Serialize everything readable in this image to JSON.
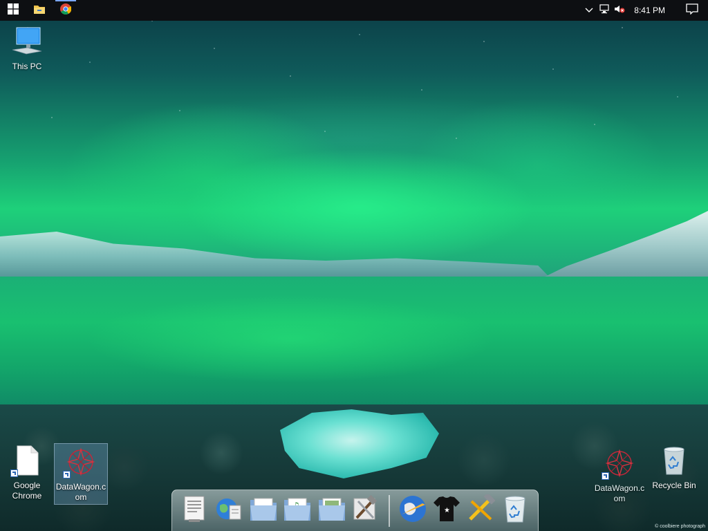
{
  "taskbar": {
    "start_icon": "windows-logo-icon",
    "pinned": [
      {
        "icon": "file-explorer-icon"
      },
      {
        "icon": "chrome-icon"
      }
    ],
    "tray": {
      "icons": [
        "chevron-up-icon",
        "network-icon",
        "volume-muted-icon"
      ],
      "clock": "8:41 PM",
      "notification_icon": "action-center-icon"
    }
  },
  "desktop_icons": {
    "this_pc": {
      "label": "This PC",
      "icon": "computer-icon"
    },
    "google_chrome": {
      "label": "Google Chrome",
      "icon": "blank-document-icon"
    },
    "datawagon_left": {
      "label": "DataWagon.com",
      "icon": "datawagon-icon"
    },
    "datawagon_right": {
      "label": "DataWagon.com",
      "icon": "datawagon-icon"
    },
    "recycle_bin": {
      "label": "Recycle Bin",
      "icon": "recycle-bin-icon"
    }
  },
  "dock": {
    "items": [
      "text-editor-icon",
      "globe-document-icon",
      "folder-icon",
      "music-folder-icon",
      "pictures-folder-icon",
      "tools-icon",
      "web-browser-icon",
      "t-shirt-icon",
      "hammer-wrench-icon",
      "recycle-bin-icon"
    ]
  },
  "wallpaper": {
    "credit": "© coolbiere photograph",
    "colors": {
      "aurora": "#1ed07a",
      "sky": "#0b3a44",
      "lake": "#19c070"
    }
  }
}
